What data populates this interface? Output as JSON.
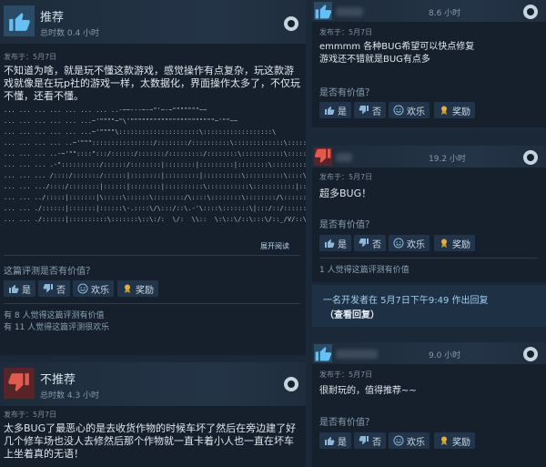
{
  "reviews_left": [
    {
      "verdict": "推荐",
      "hours": "总时数 0.4 小时",
      "posted": "发布于：5月7日",
      "text": "不知道为啥，就是玩不懂这款游戏，感觉操作有点复杂，玩这款游戏就像是在玩p社的游戏一样，太数据化，界面操作太多了，不仅玩不懂，还看不懂。",
      "ascii_art": [
        "... ... ... ... ... ... ... ..-~~---~-~\"'~-~\"\"\"\"\"\"\"~~",
        "... ... ... ... ... ...~'\"\"\"\"~\"\\'\"\"\"\"\"\"\"\"\"\"\"\"\"\"\"\"\"\"\"\"\"\"~'\"\"~~",
        "... ... ... ... ... ...~'\"\"\"\"\\:::::::::::::::::::::\\::::::::::::::::::\\",
        "... ... ... ... ..~'\"\"\"::::::::::::::::/::::::::/::::::::::\\:::::::::::::\\::::::::::\\",
        "... ... ... ..-~'\"\"::::\":::/::::::/:::::::/:::::::::/::::::::\\:::::::::::\\::::::::::\\",
        "... ... ... .-\"::::::::::/::::::/::::::::|::::::::|:::::::::|::::::::\\:::::::::\\:::::\\",
        "... ... ... /::::/:::::::/::::::|::::::::|:::::::::|::::::::::\\::::::::::\\::::\\::::\\",
        "... ... .../::::/::::::::|::::::|::::::::|::::::::::\\:::::::::::\\:::::::::::|:::::|::::|",
        "... ... ../:::::|:::::::|\\:::::\\::::::\\::::::::/\\::::\\::::::::\\::::::::/\\::::::/::::|",
        "... ... ./::::::|:::::::|::::::\\-.::::\\/\\:::/::\\.-'\\::::\\:::::::\\|:::/::/::::::|",
        "... ... ./::::::|::::::::::\\:::::::\\::\\:/:  \\/:  \\\\::  \\:\\::\\/::\\:::\\/::_/V/::\\::::/"
      ],
      "expand": "展开阅读",
      "helpful_q": "这篇评测是否有价值？",
      "buttons": [
        "是",
        "否",
        "欢乐",
        "奖励"
      ],
      "stats": [
        "有 8 人觉得这篇评测有价值",
        "有 11 人觉得这篇评测很欢乐"
      ]
    },
    {
      "verdict": "不推荐",
      "hours": "总时数 4.3 小时",
      "posted": "发布于：5月7日",
      "text": "太多BUG了最恶心的是去收货作物的时候车坏了然后在旁边建了好几个修车场也没人去修然后那个作物就一直卡着小人也一直在坏车上坐着真的无语！"
    }
  ],
  "reviews_right": [
    {
      "hours": "8.6 小时",
      "posted": "发布于：5月7日",
      "text": "emmmm 各种BUG希望可以快点修复\n游戏还不错就是BUG有点多",
      "helpful_q": "是否有价值？",
      "buttons": [
        "是",
        "否",
        "欢乐",
        "奖励"
      ]
    },
    {
      "hours": "19.2 小时",
      "posted": "发布于：5月7日",
      "text": "超多BUG！",
      "helpful_q": "是否有价值？",
      "buttons": [
        "是",
        "否",
        "欢乐",
        "奖励"
      ],
      "stat": "1 人觉得这篇评测有价值"
    },
    {
      "hours": "9.0 小时",
      "posted": "发布于：5月7日",
      "text": "很耐玩的，值得推荐~~",
      "helpful_q": "是否有价值？",
      "buttons": [
        "是",
        "否",
        "欢乐",
        "奖励"
      ]
    }
  ],
  "dev_response": {
    "text": "一名开发者在 5月7日下午9:49 作出回复",
    "link": "（查看回复）"
  },
  "colors": {
    "thumb_up": "#2a4a66",
    "thumb_down": "#562527",
    "accent_link": "#9fd0f0"
  }
}
